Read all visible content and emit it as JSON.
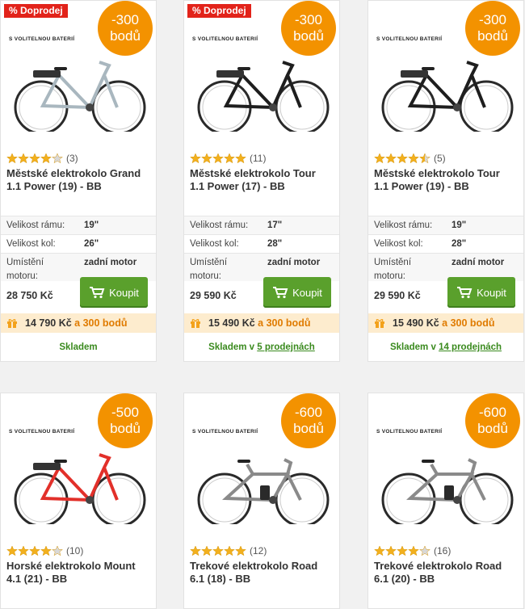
{
  "colors": {
    "accent_green": "#5aa02c",
    "badge_orange": "#f39200",
    "sale_red": "#e2231a",
    "bonus_bg": "#fdecce"
  },
  "products": [
    {
      "sale_badge": "% Doprodej",
      "points_line1": "-300",
      "points_line2": "bodů",
      "image_label": "S VOLITELNOU BATERIÍ",
      "bike_color": "#a9b7bf",
      "rating": 4,
      "rating_count": "(3)",
      "title": "Městské elektrokolo Grand 1.1 Power (19) - BB",
      "specs": [
        {
          "label": "Velikost rámu:",
          "value": "19\""
        },
        {
          "label": "Velikost kol:",
          "value": "26\""
        },
        {
          "label": "Umístění",
          "value": "zadní motor"
        }
      ],
      "spec_label_cont": "motoru:",
      "price": "28 750 Kč",
      "buy_label": "Koupit",
      "bonus_price": "14 790 Kč",
      "bonus_mid": " a ",
      "bonus_points": "300 bodů",
      "stock_text": "Skladem",
      "stock_link": ""
    },
    {
      "sale_badge": "% Doprodej",
      "points_line1": "-300",
      "points_line2": "bodů",
      "image_label": "S VOLITELNOU BATERIÍ",
      "bike_color": "#1e1e1e",
      "rating": 5,
      "rating_count": "(11)",
      "title": "Městské elektrokolo Tour 1.1 Power (17) - BB",
      "specs": [
        {
          "label": "Velikost rámu:",
          "value": "17\""
        },
        {
          "label": "Velikost kol:",
          "value": "28\""
        },
        {
          "label": "Umístění",
          "value": "zadní motor"
        }
      ],
      "spec_label_cont": "motoru:",
      "price": "29 590 Kč",
      "buy_label": "Koupit",
      "bonus_price": "15 490 Kč",
      "bonus_mid": " a ",
      "bonus_points": "300 bodů",
      "stock_text": "Skladem v ",
      "stock_link": "5 prodejnách"
    },
    {
      "sale_badge": "",
      "points_line1": "-300",
      "points_line2": "bodů",
      "image_label": "S VOLITELNOU BATERIÍ",
      "bike_color": "#1e1e1e",
      "rating": 4.5,
      "rating_count": "(5)",
      "title": "Městské elektrokolo Tour 1.1 Power (19) - BB",
      "specs": [
        {
          "label": "Velikost rámu:",
          "value": "19\""
        },
        {
          "label": "Velikost kol:",
          "value": "28\""
        },
        {
          "label": "Umístění",
          "value": "zadní motor"
        }
      ],
      "spec_label_cont": "motoru:",
      "price": "29 590 Kč",
      "buy_label": "Koupit",
      "bonus_price": "15 490 Kč",
      "bonus_mid": " a ",
      "bonus_points": "300 bodů",
      "stock_text": "Skladem v ",
      "stock_link": "14 prodejnách"
    },
    {
      "sale_badge": "",
      "points_line1": "-500",
      "points_line2": "bodů",
      "image_label": "S VOLITELNOU BATERIÍ",
      "bike_color": "#e2302a",
      "rating": 4,
      "rating_count": "(10)",
      "title": "Horské elektrokolo Mount 4.1 (21) - BB"
    },
    {
      "sale_badge": "",
      "points_line1": "-600",
      "points_line2": "bodů",
      "image_label": "S VOLITELNOU BATERIÍ",
      "bike_color": "#8a8a8a",
      "rating": 5,
      "rating_count": "(12)",
      "title": "Trekové elektrokolo Road 6.1 (18) - BB"
    },
    {
      "sale_badge": "",
      "points_line1": "-600",
      "points_line2": "bodů",
      "image_label": "S VOLITELNOU BATERIÍ",
      "bike_color": "#8a8a8a",
      "rating": 4,
      "rating_count": "(16)",
      "title": "Trekové elektrokolo Road 6.1 (20) - BB"
    }
  ]
}
